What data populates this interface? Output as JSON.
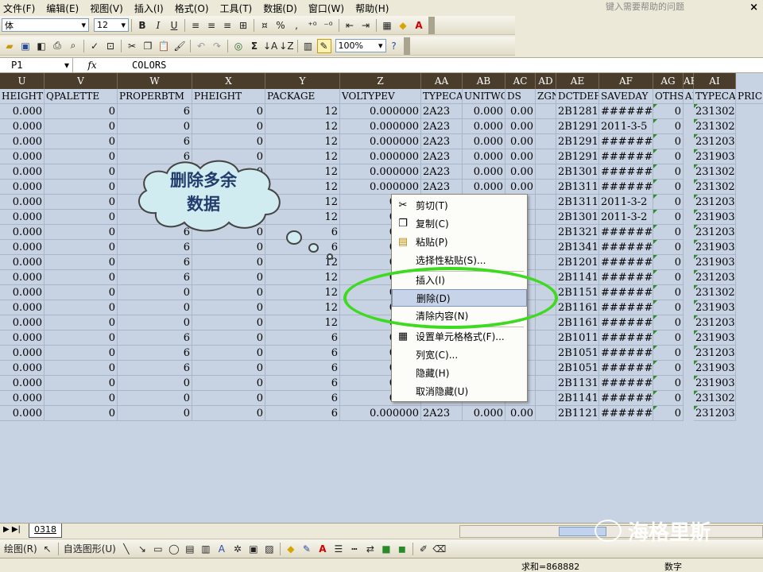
{
  "menu": {
    "items": [
      "文件(F)",
      "编辑(E)",
      "视图(V)",
      "插入(I)",
      "格式(O)",
      "工具(T)",
      "数据(D)",
      "窗口(W)",
      "帮助(H)"
    ],
    "help_placeholder": "键入需要帮助的问题"
  },
  "toolbar1": {
    "font_name": "体",
    "font_size": "12",
    "bold": "B",
    "italic": "I",
    "underline": "U",
    "percent": "%",
    "comma": ","
  },
  "toolbar2": {
    "zoom": "100%",
    "sigma": "Σ"
  },
  "formula_bar": {
    "name_box": "P1",
    "fx": "fx",
    "content": "COLORS"
  },
  "columns": [
    "U",
    "V",
    "W",
    "X",
    "Y",
    "Z",
    "AA",
    "AB",
    "AC",
    "AD",
    "AE",
    "AF",
    "AG",
    "AH",
    "AI"
  ],
  "field_headers": [
    "HEIGHT",
    "QPALETTE",
    "PROPERBTM",
    "PHEIGHT",
    "PACKAGE",
    "VOLTYPEV",
    "TYPECAI",
    "UNITWGT",
    "DS",
    "ZGN",
    "DCTDEF",
    "SAVEDAY",
    "OTHS",
    "AI",
    "TYPECAI",
    "PRIC"
  ],
  "rows": [
    [
      "0.000",
      "0",
      "6",
      "0",
      "12",
      "0.000000",
      "2A23",
      "0.000",
      "0.00",
      "",
      "2B1281",
      "########",
      "0",
      "231302"
    ],
    [
      "0.000",
      "0",
      "0",
      "0",
      "12",
      "0.000000",
      "2A23",
      "0.000",
      "0.00",
      "",
      "2B1291",
      "2011-3-5",
      "0",
      "231302"
    ],
    [
      "0.000",
      "0",
      "6",
      "0",
      "12",
      "0.000000",
      "2A23",
      "0.000",
      "0.00",
      "",
      "2B1291",
      "########",
      "0",
      "231203"
    ],
    [
      "0.000",
      "0",
      "6",
      "0",
      "12",
      "0.000000",
      "2A23",
      "0.000",
      "0.00",
      "",
      "2B1291",
      "########",
      "0",
      "231903"
    ],
    [
      "0.000",
      "0",
      "6",
      "0",
      "12",
      "0.000000",
      "2A23",
      "0.000",
      "0.00",
      "",
      "2B1301",
      "########",
      "0",
      "231302"
    ],
    [
      "0.000",
      "0",
      "6",
      "0",
      "12",
      "0.000000",
      "2A23",
      "0.000",
      "0.00",
      "",
      "2B1311",
      "########",
      "0",
      "231302"
    ],
    [
      "0.000",
      "0",
      "6",
      "0",
      "12",
      "0.000",
      "",
      "",
      "",
      "",
      "2B1311",
      "2011-3-2",
      "0",
      "231203"
    ],
    [
      "0.000",
      "0",
      "6",
      "0",
      "12",
      "0.000",
      "",
      "",
      "",
      "",
      "2B1301",
      "2011-3-2",
      "0",
      "231903"
    ],
    [
      "0.000",
      "0",
      "6",
      "0",
      "6",
      "0.000",
      "",
      "",
      "",
      "",
      "2B1321",
      "########",
      "0",
      "231203"
    ],
    [
      "0.000",
      "0",
      "6",
      "0",
      "6",
      "0.000",
      "",
      "",
      "",
      "",
      "2B1341",
      "########",
      "0",
      "231903"
    ],
    [
      "0.000",
      "0",
      "6",
      "0",
      "12",
      "0.000",
      "",
      "",
      "",
      "",
      "2B1201",
      "########",
      "0",
      "231903"
    ],
    [
      "0.000",
      "0",
      "6",
      "0",
      "12",
      "0.000",
      "",
      "",
      "",
      "",
      "2B1141",
      "########",
      "0",
      "231203"
    ],
    [
      "0.000",
      "0",
      "0",
      "0",
      "12",
      "0.000",
      "",
      "",
      "",
      "",
      "2B1151",
      "########",
      "0",
      "231302"
    ],
    [
      "0.000",
      "0",
      "0",
      "0",
      "12",
      "0.000",
      "",
      "",
      "",
      "",
      "2B1161",
      "########",
      "0",
      "231903"
    ],
    [
      "0.000",
      "0",
      "0",
      "0",
      "12",
      "0.000",
      "",
      "",
      "",
      "",
      "2B1161",
      "########",
      "0",
      "231203"
    ],
    [
      "0.000",
      "0",
      "6",
      "0",
      "6",
      "0.000",
      "",
      "",
      "",
      "",
      "2B1011",
      "########",
      "0",
      "231903"
    ],
    [
      "0.000",
      "0",
      "6",
      "0",
      "6",
      "0.000",
      "",
      "",
      "",
      "",
      "2B1051",
      "########",
      "0",
      "231203"
    ],
    [
      "0.000",
      "0",
      "6",
      "0",
      "6",
      "0.000",
      "",
      "",
      "",
      "",
      "2B1051",
      "########",
      "0",
      "231903"
    ],
    [
      "0.000",
      "0",
      "0",
      "0",
      "6",
      "0.000",
      "",
      "",
      "",
      "",
      "2B1131",
      "########",
      "0",
      "231903"
    ],
    [
      "0.000",
      "0",
      "0",
      "0",
      "6",
      "0.000",
      "",
      "",
      "",
      "",
      "2B1141",
      "########",
      "0",
      "231302"
    ],
    [
      "0.000",
      "0",
      "0",
      "0",
      "6",
      "0.000000",
      "2A23",
      "0.000",
      "0.00",
      "",
      "2B1121",
      "########",
      "0",
      "231203"
    ]
  ],
  "callout": {
    "line1": "删除多余",
    "line2": "数据"
  },
  "context_menu": {
    "cut": "剪切(T)",
    "copy": "复制(C)",
    "paste": "粘贴(P)",
    "paste_special": "选择性粘贴(S)...",
    "insert": "插入(I)",
    "delete": "删除(D)",
    "clear": "清除内容(N)",
    "format_cells": "设置单元格格式(F)...",
    "col_width": "列宽(C)...",
    "hide": "隐藏(H)",
    "unhide": "取消隐藏(U)"
  },
  "sheet_tab": "0318",
  "drawing": {
    "draw": "绘图(R)",
    "autoshapes": "自选图形(U)"
  },
  "status": {
    "sum": "求和=868882",
    "mode": "数字"
  },
  "watermark": "海格里斯"
}
